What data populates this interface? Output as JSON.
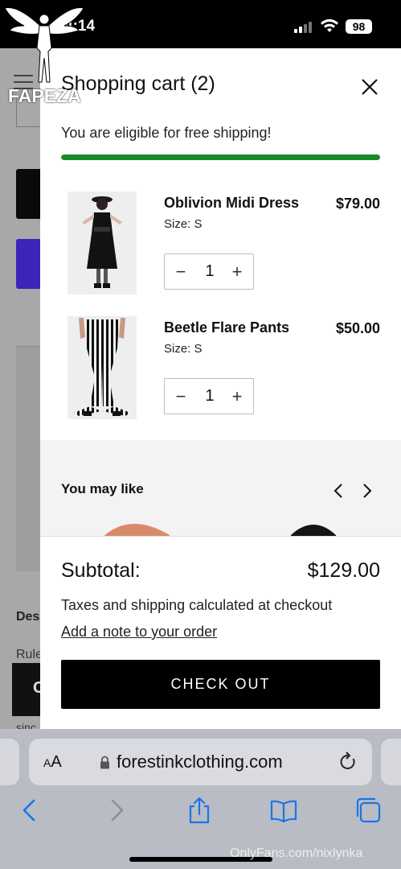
{
  "status_bar": {
    "time": "4:14",
    "battery": "98"
  },
  "background_page": {
    "heading_partial": "Des",
    "text_partial": "Rule",
    "small_partial": "sinc",
    "dark_btn_partial": "C"
  },
  "watermark": {
    "brand": "FAPEZA",
    "bottom_right": "OnlyFans.com/nixlynka"
  },
  "cart": {
    "title": "Shopping cart (2)",
    "free_shipping_message": "You are eligible for free shipping!",
    "free_shipping_progress": 1.0,
    "items": [
      {
        "name": "Oblivion Midi Dress",
        "price": "$79.00",
        "size": "Size: S",
        "quantity": "1"
      },
      {
        "name": "Beetle Flare Pants",
        "price": "$50.00",
        "size": "Size: S",
        "quantity": "1"
      }
    ],
    "recommendations_title": "You may like",
    "subtotal_label": "Subtotal:",
    "subtotal_value": "$129.00",
    "tax_note": "Taxes and shipping calculated at checkout",
    "note_link": "Add a note to your order",
    "checkout_label": "CHECK OUT"
  },
  "browser": {
    "text_size_label": "AA",
    "url": "forestinkclothing.com",
    "toolbar": [
      "back-icon",
      "forward-icon",
      "share-icon",
      "bookmarks-icon",
      "tabs-icon"
    ]
  },
  "colors": {
    "accent_green": "#178a2b",
    "purple_button": "#3b25b8",
    "safari_blue": "#1a74e8"
  }
}
